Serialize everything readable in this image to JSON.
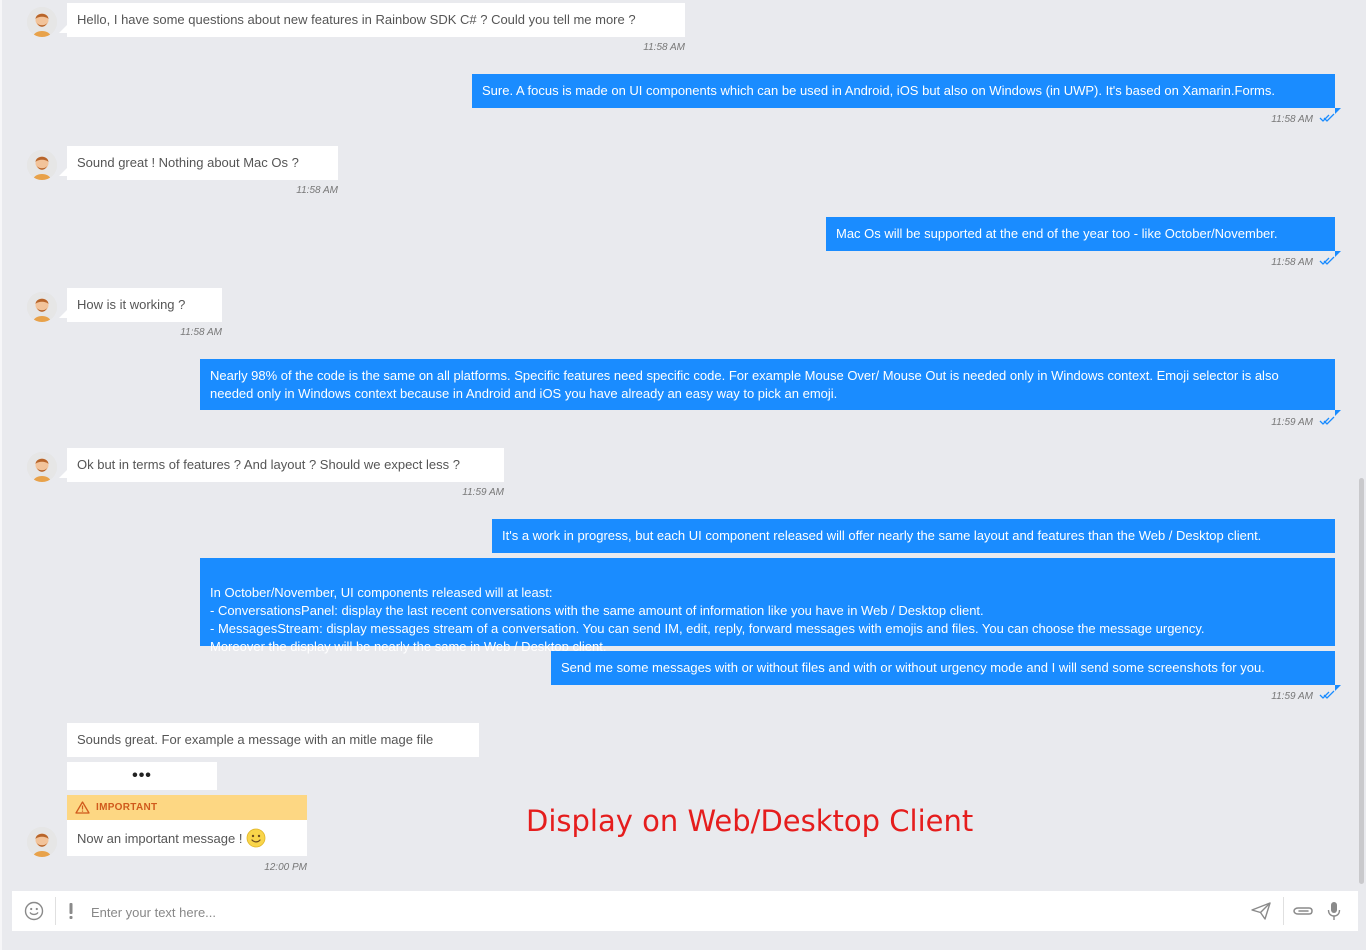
{
  "messages": [
    {
      "text": "Hello, I have some questions about new features in Rainbow SDK C# ? Could you tell me more ?",
      "time": "11:58 AM"
    },
    {
      "text": "Sure. A focus is made on UI components which can be used in Android, iOS but also on Windows (in UWP). It's based on Xamarin.Forms.",
      "time": "11:58 AM"
    },
    {
      "text": "Sound great ! Nothing about Mac Os ?",
      "time": "11:58 AM"
    },
    {
      "text": "Mac Os will be supported at the end of the year too - like October/November.",
      "time": "11:58 AM"
    },
    {
      "text": "How is it working ?",
      "time": "11:58 AM"
    },
    {
      "text": "Nearly 98% of the code is the same on all platforms. Specific features need specific code. For example Mouse Over/ Mouse Out is needed only in Windows context. Emoji selector is also needed only in Windows context because in Android and iOS you have already an easy way to pick an emoji.",
      "time": "11:59 AM"
    },
    {
      "text": "Ok but in terms of features ? And layout ? Should we expect less ?",
      "time": "11:59 AM"
    },
    {
      "text": "It's a work in progress, but each UI component released will offer nearly the same layout and features than the Web / Desktop client."
    },
    {
      "text": "In October/November, UI components released will at least:\n- ConversationsPanel: display the last recent conversations with the same amount of information like you have in Web / Desktop client.\n- MessagesStream: display messages stream of a conversation. You can send IM, edit, reply, forward messages with emojis and files. You can choose the message urgency.\nMoreover the display will be nearly the same in Web / Desktop client."
    },
    {
      "text": "Send me some messages with or without files and with or without urgency mode and I will send some screenshots for you.",
      "time": "11:59 AM"
    },
    {
      "text": "Sounds great. For example a message with an mitle mage file"
    },
    {
      "text": "•••"
    },
    {
      "badge": "IMPORTANT",
      "text": "Now an important message !",
      "emoji": "slightly-smiling-face",
      "time": "12:00 PM"
    }
  ],
  "overlay_label": "Display on Web/Desktop Client",
  "composer": {
    "placeholder": "Enter your text here...",
    "emoji_icon": "smiley-icon",
    "urgency_icon": "exclamation-icon",
    "send_icon": "paper-plane-icon",
    "attach_icon": "paperclip-icon",
    "mic_icon": "microphone-icon"
  },
  "colors": {
    "background": "#e9eaee",
    "outgoing_bubble": "#1a8cff",
    "incoming_bubble": "#ffffff",
    "important_header": "#fdd783",
    "important_text": "#d05a1c",
    "read_receipt": "#1a8cff",
    "overlay_label": "#e51d1d"
  }
}
